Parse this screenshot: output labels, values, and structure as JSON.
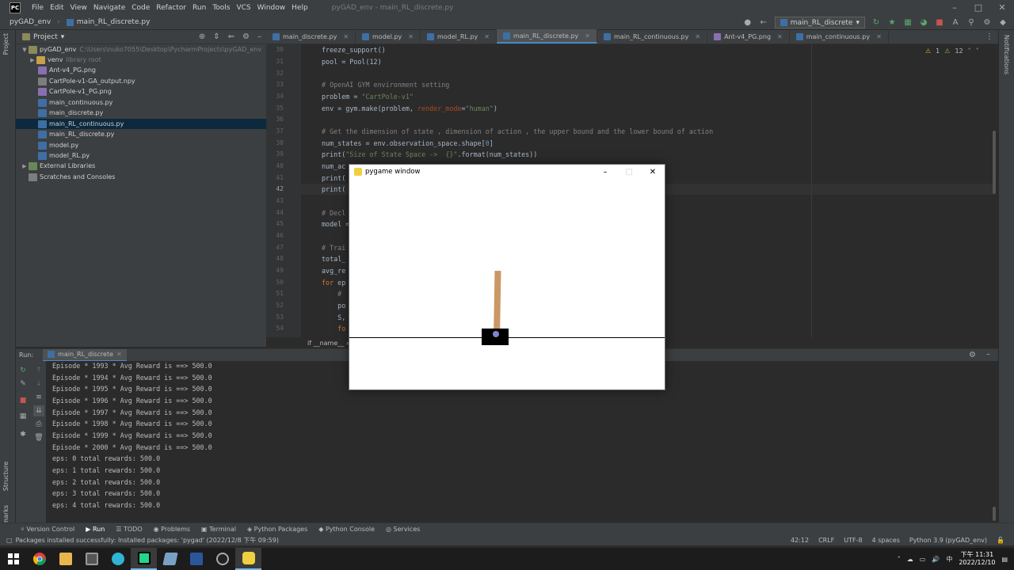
{
  "titlebar": {
    "logo": "PC",
    "menu": [
      "File",
      "Edit",
      "View",
      "Navigate",
      "Code",
      "Refactor",
      "Run",
      "Tools",
      "VCS",
      "Window",
      "Help"
    ],
    "window_title": "pyGAD_env - main_RL_discrete.py"
  },
  "navbar": {
    "project": "pyGAD_env",
    "file": "main_RL_discrete.py",
    "run_config": "main_RL_discrete"
  },
  "project_panel": {
    "title": "Project",
    "tree": [
      {
        "label": "pyGAD_env",
        "extra": "C:\\Users\\nuko7055\\Desktop\\PycharmProjects\\pyGAD_env"
      },
      {
        "label": "venv",
        "extra": "library root"
      },
      {
        "label": "Ant-v4_PG.png"
      },
      {
        "label": "CartPole-v1-GA_output.npy"
      },
      {
        "label": "CartPole-v1_PG.png"
      },
      {
        "label": "main_continuous.py"
      },
      {
        "label": "main_discrete.py"
      },
      {
        "label": "main_RL_continuous.py"
      },
      {
        "label": "main_RL_discrete.py"
      },
      {
        "label": "model.py"
      },
      {
        "label": "model_RL.py"
      },
      {
        "label": "External Libraries"
      },
      {
        "label": "Scratches and Consoles"
      }
    ]
  },
  "tabs": [
    "main_discrete.py",
    "model.py",
    "model_RL.py",
    "main_RL_discrete.py",
    "main_RL_continuous.py",
    "Ant-v4_PG.png",
    "main_continuous.py"
  ],
  "editor": {
    "line_numbers": [
      "30",
      "31",
      "32",
      "33",
      "34",
      "35",
      "36",
      "37",
      "38",
      "39",
      "40",
      "41",
      "42",
      "43",
      "44",
      "45",
      "46",
      "47",
      "48",
      "49",
      "50",
      "51",
      "52",
      "53",
      "54"
    ],
    "current_line": "42",
    "code": {
      "l30": "freeze_support()",
      "l31": "pool = Pool(12)",
      "l33": "# OpenAI GYM environment setting",
      "l34a": "problem = ",
      "l34b": "\"CartPole-v1\"",
      "l35a": "env = gym.make(problem, ",
      "l35b": "render_mode",
      "l35c": "=",
      "l35d": "\"human\"",
      "l35e": ")",
      "l37": "# Get the dimension of state , dimension of action , the upper bound and the lower bound of action",
      "l38a": "num_states = env.observation_space.shape[",
      "l38b": "0",
      "l38c": "]",
      "l39a": "print(",
      "l39b": "\"Size of State Space ->  {}\"",
      "l39c": ".format(num_states))",
      "l40": "num_ac",
      "l41": "print(",
      "l42": "print(",
      "l44": "# Decl",
      "l45": "model =",
      "l47": "# Trai",
      "l48": "total_",
      "l49": "avg_re",
      "l50a": "for",
      "l50b": " ep",
      "l51": "    #",
      "l52": "    po",
      "l53": "    S,",
      "l54": "    fo"
    },
    "breadcrumb": "if __name__ == '__main__'",
    "inspection": {
      "warnings": "1",
      "weak": "12"
    }
  },
  "run_panel": {
    "label": "Run:",
    "tab": "main_RL_discrete",
    "lines": [
      "Episode * 1993 * Avg Reward is ==> 500.0",
      "Episode * 1994 * Avg Reward is ==> 500.0",
      "Episode * 1995 * Avg Reward is ==> 500.0",
      "Episode * 1996 * Avg Reward is ==> 500.0",
      "Episode * 1997 * Avg Reward is ==> 500.0",
      "Episode * 1998 * Avg Reward is ==> 500.0",
      "Episode * 1999 * Avg Reward is ==> 500.0",
      "Episode * 2000 * Avg Reward is ==> 500.0",
      "eps: 0 total rewards: 500.0",
      "eps: 1 total rewards: 500.0",
      "eps: 2 total rewards: 500.0",
      "eps: 3 total rewards: 500.0",
      "eps: 4 total rewards: 500.0"
    ]
  },
  "bottom_tools": [
    "Version Control",
    "Run",
    "TODO",
    "Problems",
    "Terminal",
    "Python Packages",
    "Python Console",
    "Services"
  ],
  "statusbar": {
    "message": "Packages installed successfully: Installed packages: 'pygad' (2022/12/8 下午 09:59)",
    "position": "42:12",
    "line_sep": "CRLF",
    "encoding": "UTF-8",
    "indent": "4 spaces",
    "interpreter": "Python 3.9 (pyGAD_env)"
  },
  "side_labels": {
    "project": "Project",
    "structure": "Structure",
    "bookmarks": "Bookmarks",
    "notifications": "Notifications"
  },
  "pygame": {
    "title": "pygame window"
  },
  "taskbar": {
    "time": "下午 11:31",
    "date": "2022/12/10",
    "ime": "中"
  }
}
